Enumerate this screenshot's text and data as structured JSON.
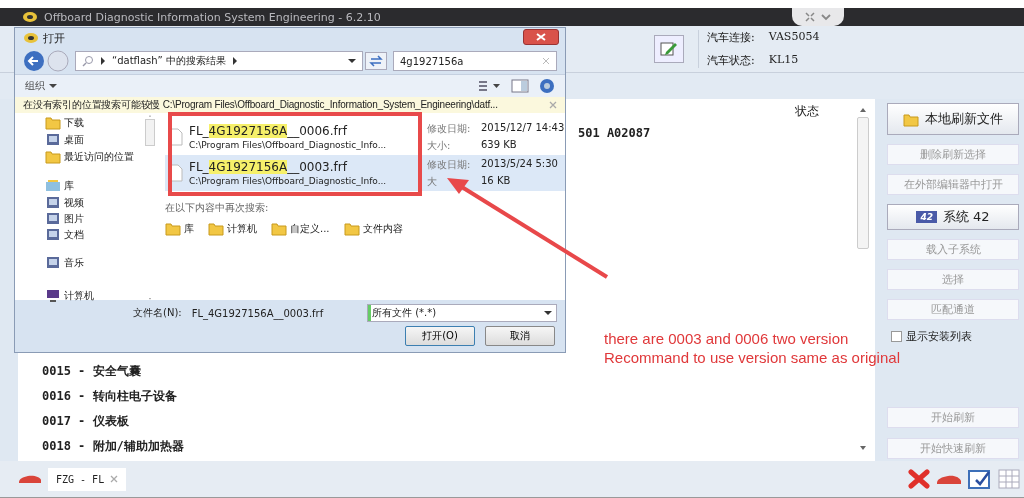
{
  "app": {
    "title": "Offboard Diagnostic Information System Engineering - 6.2.10"
  },
  "vehicle": [
    {
      "label": "汽车连接:",
      "value": "VAS5054"
    },
    {
      "label": "汽车状态:",
      "value": "KL15"
    }
  ],
  "content": {
    "column": "状态",
    "id_text": "501 A02087",
    "rows": [
      "0015 - 安全气囊",
      "0016 - 转向柱电子设备",
      "0017 - 仪表板",
      "0018 - 附加/辅助加热器"
    ]
  },
  "actions": [
    {
      "kind": "folder-button",
      "label": "本地刷新文件",
      "raised": true
    },
    {
      "kind": "button",
      "label": "删除刷新选择",
      "raised": false
    },
    {
      "kind": "button",
      "label": "在外部编辑器中打开",
      "raised": false
    },
    {
      "kind": "badge-button",
      "label": "系统 42",
      "badge": "42",
      "raised": true
    },
    {
      "kind": "button",
      "label": "载入子系统",
      "raised": false
    },
    {
      "kind": "button",
      "label": "选择",
      "raised": false
    },
    {
      "kind": "button",
      "label": "匹配通道",
      "raised": false
    },
    {
      "kind": "checkbox",
      "label": "显示安装列表",
      "checked": false
    }
  ],
  "run_actions": [
    {
      "label": "开始刷新"
    },
    {
      "label": "开始快速刷新"
    }
  ],
  "tabs": [
    {
      "label": "FZG - FL",
      "selected": true
    }
  ],
  "dialog": {
    "title": "打开",
    "location": "“datflash” 中的搜索结果",
    "search": "4g1927156a",
    "organize": "组织",
    "notice": "在没有索引的位置搜索可能较慢 C:\\Program Files\\Offboard_Diagnostic_Information_System_Engineering\\datf...",
    "nav": [
      {
        "label": "下载",
        "kind": "folder"
      },
      {
        "label": "桌面",
        "kind": "media"
      },
      {
        "label": "最近访问的位置",
        "kind": "folder"
      },
      {
        "label": "库",
        "kind": "library",
        "children": [
          {
            "label": "视频",
            "kind": "media"
          },
          {
            "label": "图片",
            "kind": "media"
          },
          {
            "label": "文档",
            "kind": "media"
          },
          {
            "label": "音乐",
            "kind": "media"
          }
        ]
      },
      {
        "label": "计算机",
        "kind": "computer"
      }
    ],
    "results": [
      {
        "prefix": "FL_",
        "match": "4G1927156A",
        "suffix": "__0006.frf",
        "path": "C:\\Program Files\\Offboard_Diagnostic_Info...",
        "date_label": "修改日期:",
        "date": "2015/12/7 14:43",
        "size_label": "大小:",
        "size": "639 KB",
        "selected": false
      },
      {
        "prefix": "FL_",
        "match": "4G1927156A",
        "suffix": "__0003.frf",
        "path": "C:\\Program Files\\Offboard_Diagnostic_Info...",
        "date_label": "修改日期:",
        "date": "2013/5/24 5:30",
        "size_label": "大",
        "size": "16 KB",
        "selected": true
      }
    ],
    "search_again": {
      "label": "在以下内容中再次搜索:",
      "options": [
        "库",
        "计算机",
        "自定义...",
        "文件内容"
      ]
    },
    "filename_label": "文件名(N):",
    "filename": "FL_4G1927156A__0003.frf",
    "filetype": "所有文件 (*.*)",
    "buttons": [
      "打开(O)",
      "取消"
    ]
  },
  "note_lines": [
    "there are 0003 and 0006 two version",
    "Recommand to use version same as original"
  ]
}
